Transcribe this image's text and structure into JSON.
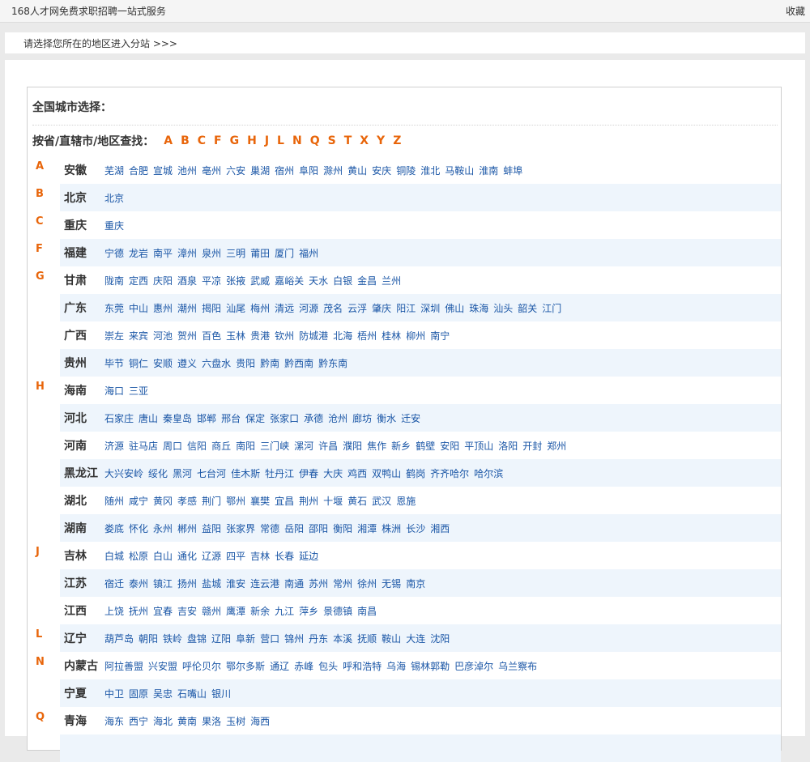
{
  "topbar": {
    "site_name": "168人才网免费求职招聘一站式服务",
    "bookmark": "收藏"
  },
  "prompt": {
    "text": "请选择您所在的地区进入分站 >>>"
  },
  "panel": {
    "title": "全国城市选择：",
    "search_label": "按省/直辖市/地区查找：",
    "letters": [
      "A",
      "B",
      "C",
      "F",
      "G",
      "H",
      "J",
      "L",
      "N",
      "Q",
      "S",
      "T",
      "X",
      "Y",
      "Z"
    ]
  },
  "colors": {
    "accent": "#e8650a",
    "link": "#1a56a6",
    "row_alt": "#eef5fc"
  },
  "provinces": [
    {
      "group": "A",
      "name": "安徽",
      "cities": [
        "芜湖",
        "合肥",
        "宣城",
        "池州",
        "亳州",
        "六安",
        "巢湖",
        "宿州",
        "阜阳",
        "滁州",
        "黄山",
        "安庆",
        "铜陵",
        "淮北",
        "马鞍山",
        "淮南",
        "蚌埠"
      ]
    },
    {
      "group": "B",
      "name": "北京",
      "cities": [
        "北京"
      ]
    },
    {
      "group": "C",
      "name": "重庆",
      "cities": [
        "重庆"
      ]
    },
    {
      "group": "F",
      "name": "福建",
      "cities": [
        "宁德",
        "龙岩",
        "南平",
        "漳州",
        "泉州",
        "三明",
        "莆田",
        "厦门",
        "福州"
      ]
    },
    {
      "group": "G",
      "name": "甘肃",
      "cities": [
        "陇南",
        "定西",
        "庆阳",
        "酒泉",
        "平凉",
        "张掖",
        "武威",
        "嘉峪关",
        "天水",
        "白银",
        "金昌",
        "兰州"
      ]
    },
    {
      "group": "",
      "name": "广东",
      "cities": [
        "东莞",
        "中山",
        "惠州",
        "潮州",
        "揭阳",
        "汕尾",
        "梅州",
        "清远",
        "河源",
        "茂名",
        "云浮",
        "肇庆",
        "阳江",
        "深圳",
        "佛山",
        "珠海",
        "汕头",
        "韶关",
        "江门"
      ]
    },
    {
      "group": "",
      "name": "广西",
      "cities": [
        "崇左",
        "来宾",
        "河池",
        "贺州",
        "百色",
        "玉林",
        "贵港",
        "钦州",
        "防城港",
        "北海",
        "梧州",
        "桂林",
        "柳州",
        "南宁"
      ]
    },
    {
      "group": "",
      "name": "贵州",
      "cities": [
        "毕节",
        "铜仁",
        "安顺",
        "遵义",
        "六盘水",
        "贵阳",
        "黔南",
        "黔西南",
        "黔东南"
      ]
    },
    {
      "group": "H",
      "name": "海南",
      "cities": [
        "海口",
        "三亚"
      ]
    },
    {
      "group": "",
      "name": "河北",
      "cities": [
        "石家庄",
        "唐山",
        "秦皇岛",
        "邯郸",
        "邢台",
        "保定",
        "张家口",
        "承德",
        "沧州",
        "廊坊",
        "衡水",
        "迁安"
      ]
    },
    {
      "group": "",
      "name": "河南",
      "cities": [
        "济源",
        "驻马店",
        "周口",
        "信阳",
        "商丘",
        "南阳",
        "三门峡",
        "漯河",
        "许昌",
        "濮阳",
        "焦作",
        "新乡",
        "鹤壁",
        "安阳",
        "平顶山",
        "洛阳",
        "开封",
        "郑州"
      ]
    },
    {
      "group": "",
      "name": "黑龙江",
      "cities": [
        "大兴安岭",
        "绥化",
        "黑河",
        "七台河",
        "佳木斯",
        "牡丹江",
        "伊春",
        "大庆",
        "鸡西",
        "双鸭山",
        "鹤岗",
        "齐齐哈尔",
        "哈尔滨"
      ]
    },
    {
      "group": "",
      "name": "湖北",
      "cities": [
        "随州",
        "咸宁",
        "黄冈",
        "孝感",
        "荆门",
        "鄂州",
        "襄樊",
        "宜昌",
        "荆州",
        "十堰",
        "黄石",
        "武汉",
        "恩施"
      ]
    },
    {
      "group": "",
      "name": "湖南",
      "cities": [
        "娄底",
        "怀化",
        "永州",
        "郴州",
        "益阳",
        "张家界",
        "常德",
        "岳阳",
        "邵阳",
        "衡阳",
        "湘潭",
        "株洲",
        "长沙",
        "湘西"
      ]
    },
    {
      "group": "J",
      "name": "吉林",
      "cities": [
        "白城",
        "松原",
        "白山",
        "通化",
        "辽源",
        "四平",
        "吉林",
        "长春",
        "延边"
      ]
    },
    {
      "group": "",
      "name": "江苏",
      "cities": [
        "宿迁",
        "泰州",
        "镇江",
        "扬州",
        "盐城",
        "淮安",
        "连云港",
        "南通",
        "苏州",
        "常州",
        "徐州",
        "无锡",
        "南京"
      ]
    },
    {
      "group": "",
      "name": "江西",
      "cities": [
        "上饶",
        "抚州",
        "宜春",
        "吉安",
        "赣州",
        "鹰潭",
        "新余",
        "九江",
        "萍乡",
        "景德镇",
        "南昌"
      ]
    },
    {
      "group": "L",
      "name": "辽宁",
      "cities": [
        "葫芦岛",
        "朝阳",
        "铁岭",
        "盘锦",
        "辽阳",
        "阜新",
        "营口",
        "锦州",
        "丹东",
        "本溪",
        "抚顺",
        "鞍山",
        "大连",
        "沈阳"
      ]
    },
    {
      "group": "N",
      "name": "内蒙古",
      "cities": [
        "阿拉善盟",
        "兴安盟",
        "呼伦贝尔",
        "鄂尔多斯",
        "通辽",
        "赤峰",
        "包头",
        "呼和浩特",
        "乌海",
        "锡林郭勒",
        "巴彦淖尔",
        "乌兰察布"
      ]
    },
    {
      "group": "",
      "name": "宁夏",
      "cities": [
        "中卫",
        "固原",
        "吴忠",
        "石嘴山",
        "银川"
      ]
    },
    {
      "group": "Q",
      "name": "青海",
      "cities": [
        "海东",
        "西宁",
        "海北",
        "黄南",
        "果洛",
        "玉树",
        "海西"
      ]
    },
    {
      "group": "",
      "name": "",
      "cities": []
    }
  ]
}
